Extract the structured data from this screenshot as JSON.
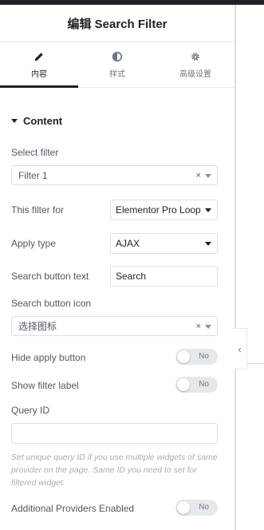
{
  "panel": {
    "title": "编辑 Search Filter"
  },
  "tabs": [
    {
      "label": "内容",
      "icon": "pencil-icon",
      "active": true
    },
    {
      "label": "样式",
      "icon": "half-circle-icon",
      "active": false
    },
    {
      "label": "高级设置",
      "icon": "gear-icon",
      "active": false
    }
  ],
  "section": {
    "title": "Content"
  },
  "fields": {
    "select_filter": {
      "label": "Select filter",
      "value": "Filter 1",
      "clear": "×"
    },
    "filter_for": {
      "label": "This filter for",
      "value": "Elementor Pro Loop"
    },
    "apply_type": {
      "label": "Apply type",
      "value": "AJAX"
    },
    "search_button_text": {
      "label": "Search button text",
      "value": "Search"
    },
    "search_button_icon": {
      "label": "Search button icon",
      "value": "选择图标",
      "clear": "×"
    },
    "hide_apply_button": {
      "label": "Hide apply button",
      "state": "No"
    },
    "show_filter_label": {
      "label": "Show filter label",
      "state": "No"
    },
    "query_id": {
      "label": "Query ID",
      "value": ""
    },
    "help_text": "Set unique query ID if you use multiple widgets of same provider on the page. Same ID you need to set for filtered widget.",
    "additional_providers": {
      "label": "Additional Providers Enabled",
      "state": "No"
    }
  },
  "collapse_icon": "chevron-left-icon",
  "colors": {
    "accent": "#1f2124",
    "border": "#dcdfe3",
    "switch_off": "#e6e9ec",
    "canvas_guide": "#e8c9ec"
  }
}
